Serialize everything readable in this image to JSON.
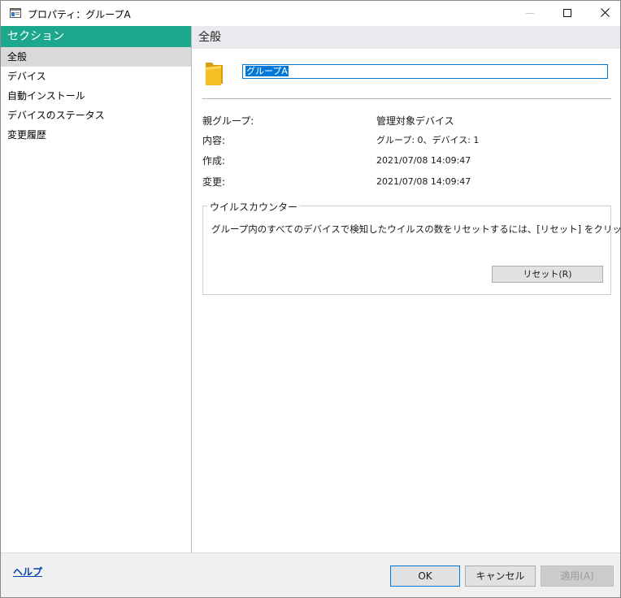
{
  "window": {
    "title": "プロパティ：グループA"
  },
  "sidebar": {
    "header": "セクション",
    "items": [
      {
        "label": "全般",
        "selected": true
      },
      {
        "label": "デバイス",
        "selected": false
      },
      {
        "label": "自動インストール",
        "selected": false
      },
      {
        "label": "デバイスのステータス",
        "selected": false
      },
      {
        "label": "変更履歴",
        "selected": false
      }
    ]
  },
  "main": {
    "header": "全般",
    "name_value": "グループA",
    "info": {
      "parent_label": "親グループ:",
      "parent_value": "管理対象デバイス",
      "content_label": "内容:",
      "content_value": "グループ: 0、デバイス: 1",
      "created_label": "作成:",
      "created_value": "2021/07/08 14:09:47",
      "modified_label": "変更:",
      "modified_value": "2021/07/08 14:09:47"
    },
    "virus_counter": {
      "legend": "ウイルスカウンター",
      "description": "グループ内のすべてのデバイスで検知したウイルスの数をリセットするには、[リセット] をクリックします。",
      "reset_label": "リセット(R)"
    }
  },
  "footer": {
    "help_label": "ヘルプ",
    "ok_label": "OK",
    "cancel_label": "キャンセル",
    "apply_label": "適用(A)"
  },
  "colors": {
    "accent": "#1ba88c",
    "selection": "#0078d7",
    "folder": "#f2b51d"
  },
  "icons": {
    "app": "properties-window-icon",
    "folder": "folder-icon",
    "minimize": "minimize-icon",
    "maximize": "maximize-icon",
    "close": "close-icon"
  }
}
